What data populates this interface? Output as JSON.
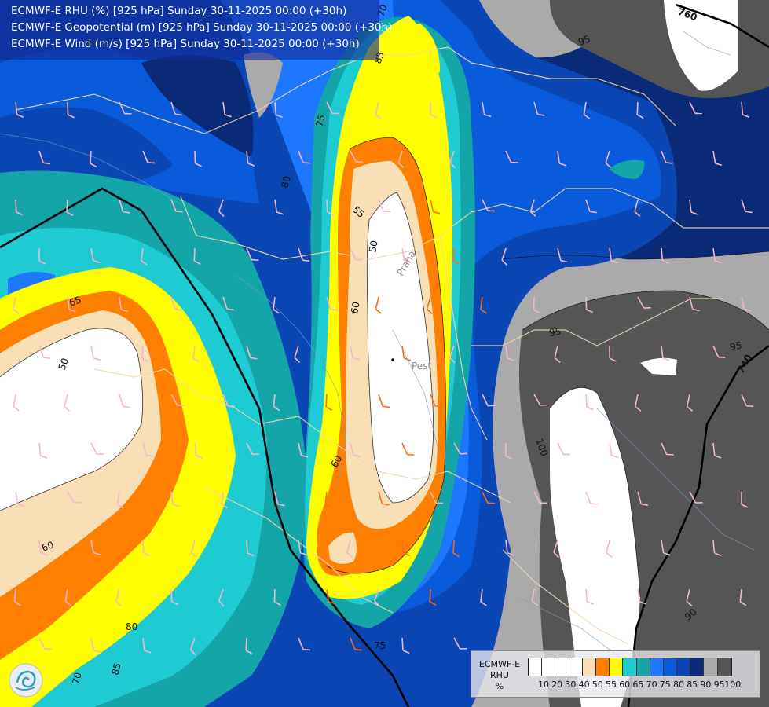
{
  "header": {
    "line1": "ECMWF-E RHU (%) [925 hPa] Sunday 30-11-2025 00:00 (+30h)",
    "line2": "ECMWF-E Geopotential (m) [925 hPa] Sunday 30-11-2025 00:00 (+30h)",
    "line3": "ECMWF-E Wind (m/s) [925 hPa] Sunday 30-11-2025 00:00 (+30h)"
  },
  "legend": {
    "title_line1": "ECMWF-E",
    "title_line2": "RHU",
    "title_line3": "%",
    "ticks": [
      "10",
      "20",
      "30",
      "40",
      "50",
      "55",
      "60",
      "65",
      "70",
      "75",
      "80",
      "85",
      "90",
      "95",
      "100"
    ],
    "colors": [
      "#ffffff",
      "#ffffff",
      "#ffffff",
      "#ffffff",
      "#f8dfb6",
      "#ff7f00",
      "#ffff00",
      "#1ecbd2",
      "#14a5a8",
      "#1e78ff",
      "#0a5adc",
      "#0a46b4",
      "#0a2a78",
      "#aaaaaa",
      "#555555"
    ]
  },
  "geopotential_labels": [
    "760",
    "740"
  ],
  "rhu_contour_labels": [
    "70",
    "85",
    "95",
    "75",
    "80",
    "55",
    "50",
    "60",
    "65",
    "60",
    "50",
    "95",
    "95",
    "100",
    "60",
    "80",
    "75",
    "85",
    "70",
    "90"
  ],
  "cities": [
    "Pest",
    "Praha"
  ],
  "palette": {
    "gray": "#aaaaaa",
    "dark_gray": "#555555",
    "navy": "#0a2a78",
    "blue": "#0a46b4",
    "blue2": "#0a5adc",
    "azure": "#1e78ff",
    "teal": "#14a5a8",
    "cyan": "#1ecbd2",
    "yellow": "#ffff00",
    "orange": "#ff7f00",
    "peach": "#f8dfb6",
    "white": "#ffffff"
  }
}
